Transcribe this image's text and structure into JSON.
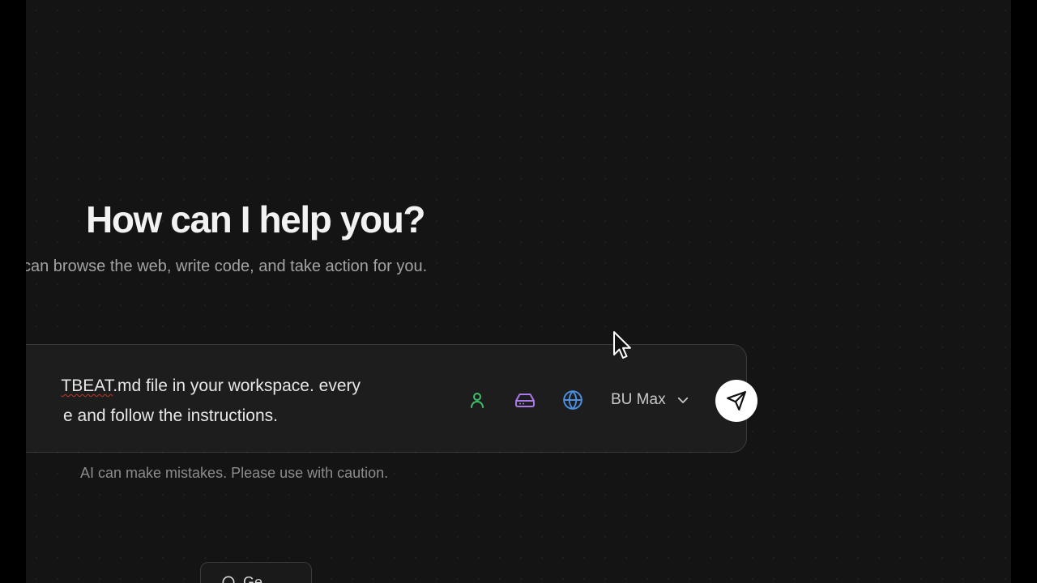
{
  "header": {
    "title": "How can I help you?",
    "subtitle": "can browse the web, write code, and take action for you."
  },
  "composer": {
    "prompt_line1_flagged": "TBEAT",
    "prompt_line1_rest": ".md file in your workspace. every",
    "prompt_line2": "e and follow the instructions.",
    "tools": [
      {
        "name": "profile",
        "icon": "person-icon",
        "color": "#3fbf6b"
      },
      {
        "name": "storage",
        "icon": "hard-drive-icon",
        "color": "#a97be8"
      },
      {
        "name": "web",
        "icon": "globe-icon",
        "color": "#4b8fe0"
      }
    ],
    "model_label": "BU Max",
    "send_icon": "send-icon"
  },
  "footer": {
    "disclaimer": "AI can make mistakes. Please use with caution.",
    "chip_label": "Ge..."
  },
  "colors": {
    "background": "#141414",
    "composer_bg": "#1d1d1d",
    "send_button": "#ffffff"
  }
}
